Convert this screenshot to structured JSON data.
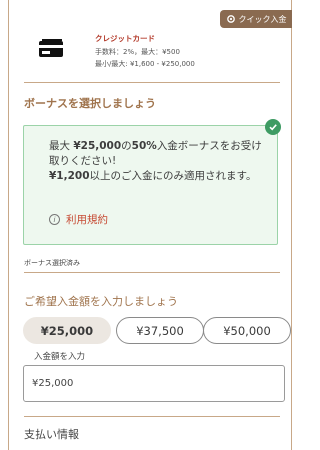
{
  "quick_tab": {
    "label": "クイック入金",
    "icon": "gear-icon"
  },
  "card": {
    "name": "クレジットカード",
    "fee_line": "手数料：2%，最大：¥500",
    "range_line": "最小/最大: ¥1,600 - ¥250,000",
    "icon": "credit-card-icon"
  },
  "bonus": {
    "title": "ボーナスを選択しましょう",
    "text_prefix": "最大 ",
    "text_amount": "¥25,000",
    "text_mid": "の",
    "text_percent": "50%",
    "text_suffix": "入金ボーナスをお受け取りください!",
    "minimum_amount": "¥1,200",
    "minimum_suffix": "以上のご入金にのみ適用されます。",
    "terms_label": "利用規約",
    "selected_label": "ボーナス選択済み"
  },
  "amount": {
    "title": "ご希望入金額を入力しましょう",
    "chips": [
      "¥25,000",
      "¥37,500",
      "¥50,000"
    ],
    "active_chip": "¥25,000",
    "input_label": "入金額を入力",
    "input_value": "¥25,000"
  },
  "payment": {
    "title": "支払い情報"
  },
  "colors": {
    "accent": "#a0744d",
    "success": "#3e9b63",
    "link": "#c64a33",
    "badge": "#8a6a50"
  }
}
